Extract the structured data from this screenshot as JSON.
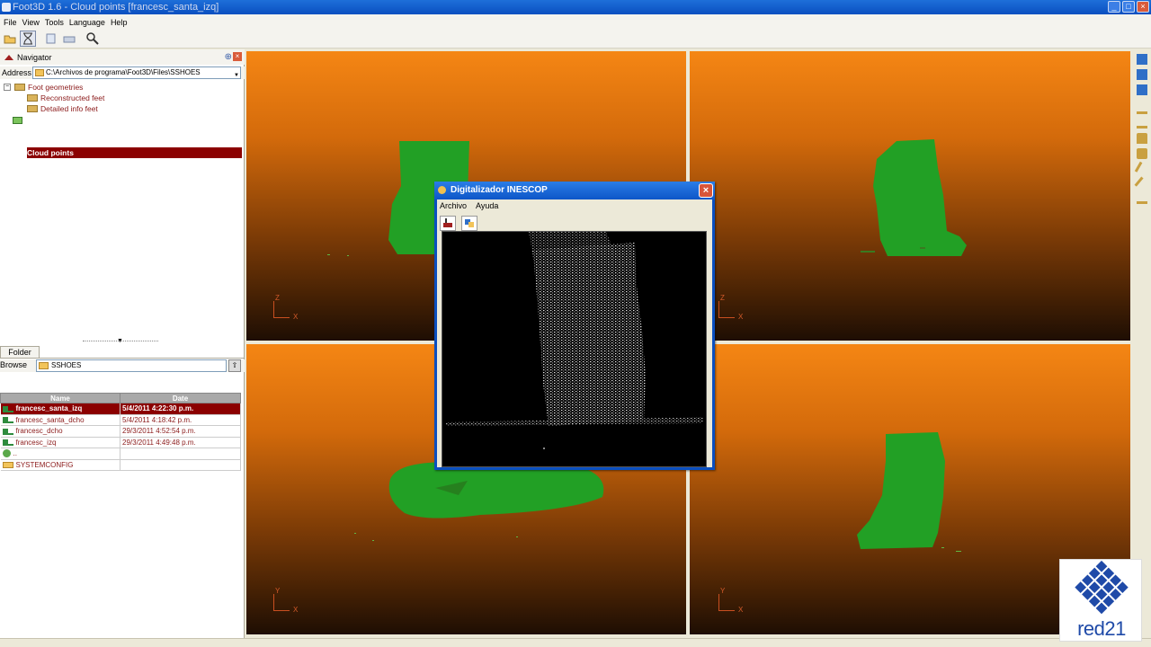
{
  "window": {
    "title": "Foot3D 1.6 - Cloud points [francesc_santa_izq]"
  },
  "menu": [
    "File",
    "View",
    "Tools",
    "Language",
    "Help"
  ],
  "toolbar": {
    "icons": [
      "open-icon",
      "hourglass-icon",
      "copy-icon",
      "print-icon",
      "zoom-icon"
    ]
  },
  "navigator": {
    "title": "Navigator",
    "address_label": "Address",
    "address_value": "C:\\Archivos de programa\\Foot3D\\Files\\SSHOES",
    "tree": [
      {
        "label": "Foot geometries",
        "level": 0,
        "expander": "⊟"
      },
      {
        "label": "Reconstructed feet",
        "level": 1
      },
      {
        "label": "Detailed info feet",
        "level": 1
      },
      {
        "label": "Cloud points",
        "level": 0,
        "selected": true
      }
    ]
  },
  "folder_panel": {
    "tab": "Folder",
    "browse_label": "Browse",
    "browse_value": "SSHOES",
    "columns": [
      "Name",
      "Date"
    ],
    "rows": [
      {
        "name": "francesc_santa_izq",
        "date": "5/4/2011 4:22:30 p.m.",
        "icon": "file",
        "selected": true
      },
      {
        "name": "francesc_santa_dcho",
        "date": "5/4/2011 4:18:42 p.m.",
        "icon": "file"
      },
      {
        "name": "francesc_dcho",
        "date": "29/3/2011 4:52:54 p.m.",
        "icon": "file"
      },
      {
        "name": "francesc_izq",
        "date": "29/3/2011 4:49:48 p.m.",
        "icon": "file"
      },
      {
        "name": "..",
        "date": "",
        "icon": "up"
      },
      {
        "name": "SYSTEMCONFIG",
        "date": "",
        "icon": "folder"
      }
    ]
  },
  "viewports": [
    {
      "axis_up": "Z",
      "axis_h": "X"
    },
    {
      "axis_up": "Z",
      "axis_h": "X"
    },
    {
      "axis_up": "Y",
      "axis_h": "X"
    },
    {
      "axis_up": "Y",
      "axis_h": "X"
    }
  ],
  "dialog": {
    "title": "Digitalizador INESCOP",
    "menu": [
      "Archivo",
      "Ayuda"
    ]
  },
  "logo": {
    "text": "red21"
  },
  "colors": {
    "accent": "#8b0000",
    "cloud": "#22a025",
    "viewport_top": "#f58614"
  }
}
